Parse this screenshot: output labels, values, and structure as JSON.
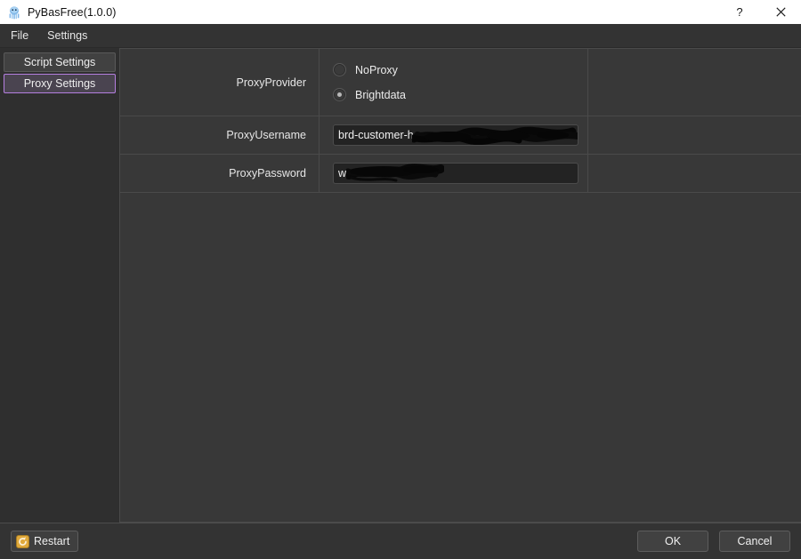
{
  "window": {
    "title": "PyBasFree(1.0.0)",
    "app_icon": "octopus-icon",
    "help_label": "?",
    "close_label": "×"
  },
  "menubar": {
    "items": [
      {
        "label": "File"
      },
      {
        "label": "Settings"
      }
    ]
  },
  "sidebar": {
    "items": [
      {
        "label": "Script Settings",
        "selected": false
      },
      {
        "label": "Proxy Settings",
        "selected": true
      }
    ]
  },
  "form": {
    "rows": [
      {
        "label": "ProxyProvider",
        "type": "radio-group",
        "options": [
          {
            "label": "NoProxy",
            "checked": false
          },
          {
            "label": "Brightdata",
            "checked": true
          }
        ]
      },
      {
        "label": "ProxyUsername",
        "type": "text",
        "value": "brd-customer-h",
        "redacted": true
      },
      {
        "label": "ProxyPassword",
        "type": "text",
        "value": "w",
        "redacted": true
      }
    ]
  },
  "bottombar": {
    "restart_label": "Restart",
    "restart_icon": "refresh-icon",
    "ok_label": "OK",
    "cancel_label": "Cancel"
  },
  "colors": {
    "titlebar_bg": "#ffffff",
    "window_bg": "#2f2f2f",
    "panel_bg": "#383838",
    "grid_line": "#4a4a4a",
    "accent_selected": "#b57fe0",
    "input_bg": "#232323",
    "restart_icon_bg": "#e0a93b",
    "text": "#ececec"
  }
}
